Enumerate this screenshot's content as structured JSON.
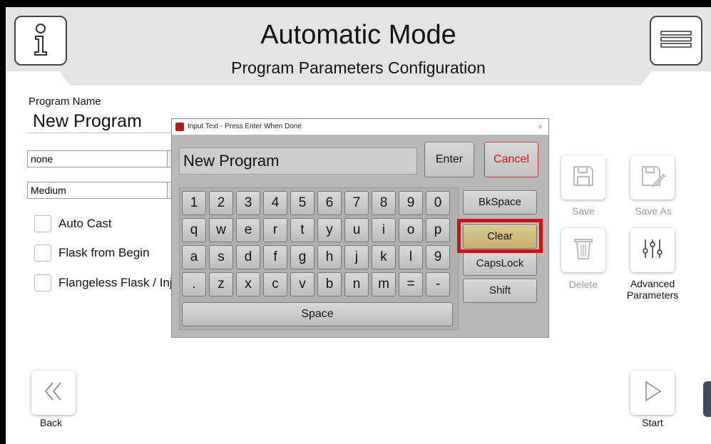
{
  "header": {
    "title": "Automatic Mode",
    "subtitle": "Program Parameters Configuration",
    "info_icon": "info-icon",
    "menu_icon": "hamburger-menu-icon"
  },
  "form": {
    "program_name_label": "Program Name",
    "program_name_value": "New Program",
    "select1_value": "none",
    "select2_value": "Medium",
    "checkboxes": [
      {
        "label": "Auto Cast"
      },
      {
        "label": "Flask from Begin"
      },
      {
        "label": "Flangeless Flask / Inj"
      }
    ]
  },
  "actions": {
    "save": "Save",
    "save_as": "Save As",
    "delete": "Delete",
    "advanced": "Advanced Parameters",
    "back": "Back",
    "start": "Start"
  },
  "dialog": {
    "title": "Input Text - Press Enter When Done",
    "close": "×",
    "input_value": "New Program",
    "enter": "Enter",
    "cancel": "Cancel",
    "rows": [
      [
        "1",
        "2",
        "3",
        "4",
        "5",
        "6",
        "7",
        "8",
        "9",
        "0"
      ],
      [
        "q",
        "w",
        "e",
        "r",
        "t",
        "y",
        "u",
        "i",
        "o",
        "p"
      ],
      [
        "a",
        "s",
        "d",
        "f",
        "g",
        "h",
        "j",
        "k",
        "l",
        "9"
      ],
      [
        ".",
        "z",
        "x",
        "c",
        "v",
        "b",
        "n",
        "m",
        "=",
        "-"
      ]
    ],
    "space": "Space",
    "side_keys": [
      "BkSpace",
      "Clear",
      "CapsLock",
      "Shift"
    ]
  },
  "colors": {
    "cancel_text": "#e01010",
    "highlight": "#d50f0f",
    "clear_key": "#d1c080"
  }
}
